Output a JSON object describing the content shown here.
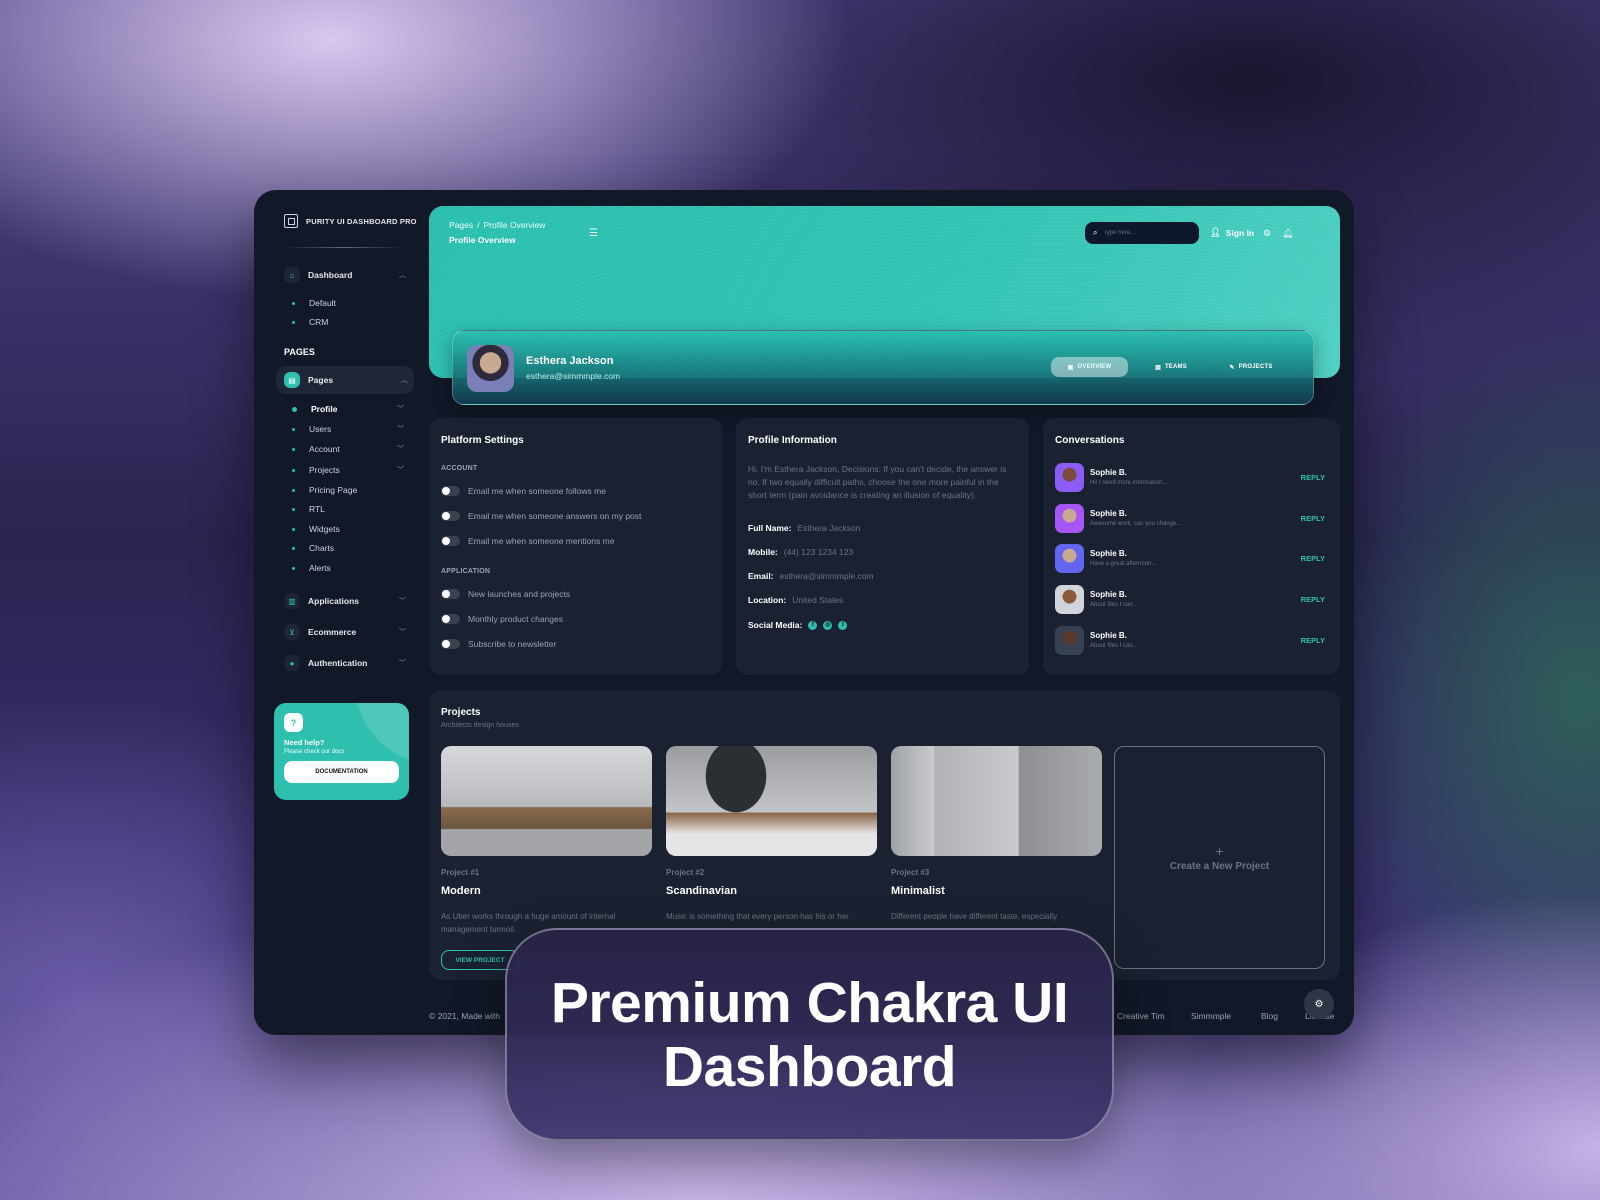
{
  "brand": {
    "name": "PURITY UI DASHBOARD PRO"
  },
  "sidebar": {
    "dashboard": {
      "label": "Dashboard",
      "items": [
        "Default",
        "CRM"
      ]
    },
    "pages_heading": "PAGES",
    "pages": {
      "label": "Pages",
      "items": [
        {
          "label": "Profile",
          "has_chevron": true,
          "active": true
        },
        {
          "label": "Users",
          "has_chevron": true
        },
        {
          "label": "Account",
          "has_chevron": true
        },
        {
          "label": "Projects",
          "has_chevron": true
        },
        {
          "label": "Pricing Page"
        },
        {
          "label": "RTL"
        },
        {
          "label": "Widgets"
        },
        {
          "label": "Charts"
        },
        {
          "label": "Alerts"
        }
      ]
    },
    "groups": [
      {
        "label": "Applications",
        "icon": "chart-icon"
      },
      {
        "label": "Ecommerce",
        "icon": "cart-icon"
      },
      {
        "label": "Authentication",
        "icon": "person-icon"
      }
    ],
    "help": {
      "title": "Need help?",
      "subtitle": "Please check our docs",
      "button": "DOCUMENTATION"
    }
  },
  "header": {
    "breadcrumb": [
      "Pages",
      "Profile Overview"
    ],
    "page_title": "Profile Overview",
    "search_placeholder": "Type here...",
    "sign_in": "Sign In"
  },
  "profile": {
    "name": "Esthera Jackson",
    "email": "esthera@simmmple.com",
    "tabs": [
      {
        "label": "OVERVIEW",
        "active": true
      },
      {
        "label": "TEAMS"
      },
      {
        "label": "PROJECTS"
      }
    ]
  },
  "platform_settings": {
    "title": "Platform Settings",
    "account_label": "ACCOUNT",
    "account": [
      "Email me when someone follows me",
      "Email me when someone answers on my post",
      "Email me when someone mentions me"
    ],
    "application_label": "APPLICATION",
    "application": [
      "New launches and projects",
      "Monthly product changes",
      "Subscribe to newsletter"
    ]
  },
  "profile_info": {
    "title": "Profile Information",
    "bio": "Hi, I'm Esthera Jackson, Decisions: If you can't decide, the answer is no. If two equally difficult paths, choose the one more painful in the short term (pain avoidance is creating an illusion of equality).",
    "fields": [
      {
        "key": "Full Name:",
        "value": "Esthera Jackson"
      },
      {
        "key": "Mobile:",
        "value": "(44) 123 1234 123"
      },
      {
        "key": "Email:",
        "value": "esthera@simmmple.com"
      },
      {
        "key": "Location:",
        "value": "United States"
      }
    ],
    "social_label": "Social Media:"
  },
  "conversations": {
    "title": "Conversations",
    "reply_label": "REPLY",
    "items": [
      {
        "name": "Sophie B.",
        "message": "Hi! I need more information...",
        "color": "#8b5cf6"
      },
      {
        "name": "Sophie B.",
        "message": "Awesome work, can you change...",
        "color": "#a855f7"
      },
      {
        "name": "Sophie B.",
        "message": "Have a great afternoon...",
        "color": "#6366f1"
      },
      {
        "name": "Sophie B.",
        "message": "About files I can...",
        "color": "#b45309"
      },
      {
        "name": "Sophie B.",
        "message": "About files I can...",
        "color": "#374151"
      }
    ]
  },
  "projects": {
    "title": "Projects",
    "subtitle": "Architects design houses",
    "view_label": "VIEW PROJECT",
    "items": [
      {
        "number": "Project #1",
        "name": "Modern",
        "desc": "As Uber works through a huge amount of internal management turmoil."
      },
      {
        "number": "Project #2",
        "name": "Scandinavian",
        "desc": "Music is something that every person has his or her"
      },
      {
        "number": "Project #3",
        "name": "Minimalist",
        "desc": "Different people have different taste, especially"
      }
    ],
    "new_project": "Create a New Project"
  },
  "footer": {
    "copyright": "© 2021, Made with",
    "links": [
      "Creative Tim",
      "Simmmple",
      "Blog",
      "License"
    ]
  },
  "overlay": {
    "line1": "Premium Chakra UI",
    "line2": "Dashboard"
  },
  "colors": {
    "accent": "#2fbfae",
    "panel": "#1a2231",
    "window": "#111827"
  }
}
